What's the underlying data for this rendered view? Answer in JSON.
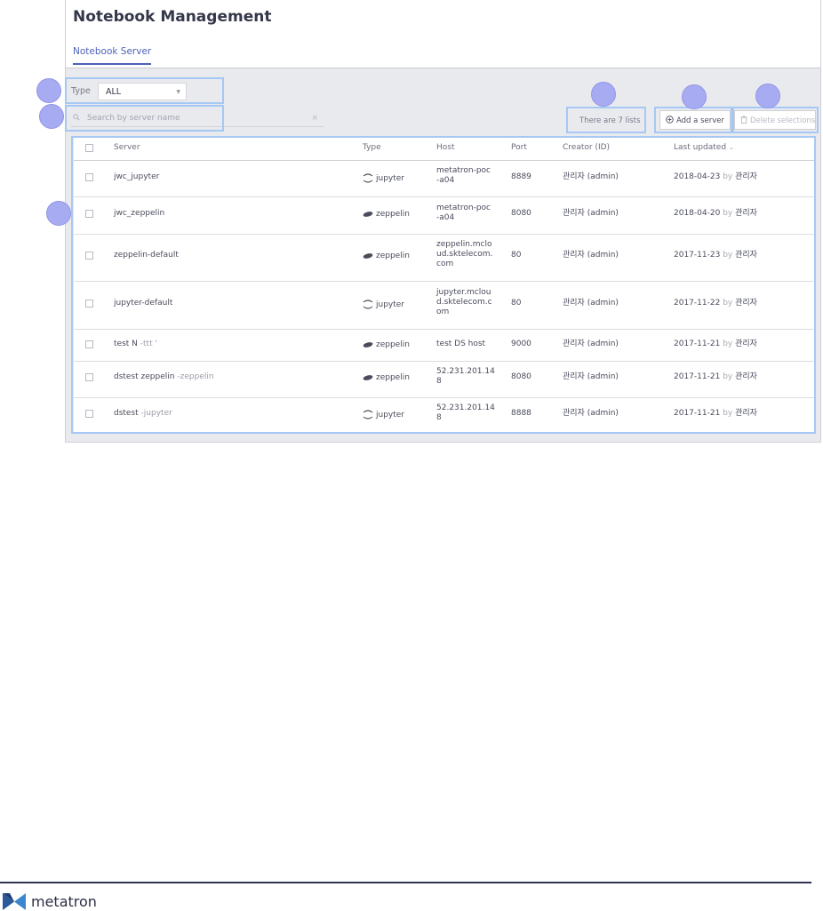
{
  "page": {
    "title": "Notebook Management",
    "tab": "Notebook Server"
  },
  "filters": {
    "type_label": "Type",
    "type_value": "ALL",
    "search_placeholder": "Search by server name",
    "search_clear": "×"
  },
  "toolbar": {
    "count_text": "There are 7 lists",
    "add_label": "Add a server",
    "delete_label": "Delete selections"
  },
  "table": {
    "columns": [
      "Server",
      "Type",
      "Host",
      "Port",
      "Creator (ID)",
      "Last updated"
    ],
    "rows": [
      {
        "server": "jwc_jupyter",
        "server_sub": "",
        "type": "jupyter",
        "host": [
          "metatron-poc",
          "-a04"
        ],
        "port": "8889",
        "creator": "관리자 (admin)",
        "date": "2018-04-23",
        "by": "by",
        "updater": "관리자"
      },
      {
        "server": "jwc_zeppelin",
        "server_sub": "",
        "type": "zeppelin",
        "host": [
          "metatron-poc",
          "-a04"
        ],
        "port": "8080",
        "creator": "관리자 (admin)",
        "date": "2018-04-20",
        "by": "by",
        "updater": "관리자"
      },
      {
        "server": "zeppelin-default",
        "server_sub": "",
        "type": "zeppelin",
        "host": [
          "zeppelin.mclo",
          "ud.sktelecom.",
          "com"
        ],
        "port": "80",
        "creator": "관리자 (admin)",
        "date": "2017-11-23",
        "by": "by",
        "updater": "관리자"
      },
      {
        "server": "jupyter-default",
        "server_sub": "",
        "type": "jupyter",
        "host": [
          "jupyter.mclou",
          "d.sktelecom.c",
          "om"
        ],
        "port": "80",
        "creator": "관리자 (admin)",
        "date": "2017-11-22",
        "by": "by",
        "updater": "관리자"
      },
      {
        "server": "test N",
        "server_sub": "-ttt '",
        "type": "zeppelin",
        "host": [
          "test DS host"
        ],
        "port": "9000",
        "creator": "관리자 (admin)",
        "date": "2017-11-21",
        "by": "by",
        "updater": "관리자"
      },
      {
        "server": "dstest zeppelin",
        "server_sub": "-zeppelin",
        "type": "zeppelin",
        "host": [
          "52.231.201.14",
          "8"
        ],
        "port": "8080",
        "creator": "관리자 (admin)",
        "date": "2017-11-21",
        "by": "by",
        "updater": "관리자"
      },
      {
        "server": "dstest",
        "server_sub": "-jupyter",
        "type": "jupyter",
        "host": [
          "52.231.201.14",
          "8"
        ],
        "port": "8888",
        "creator": "관리자 (admin)",
        "date": "2017-11-21",
        "by": "by",
        "updater": "관리자"
      }
    ]
  },
  "footer": {
    "brand": "metatron"
  },
  "colors": {
    "annotation_border": "#a5c8f5",
    "annotation_circle": "#a7abf1",
    "accent": "#4d61b8"
  }
}
